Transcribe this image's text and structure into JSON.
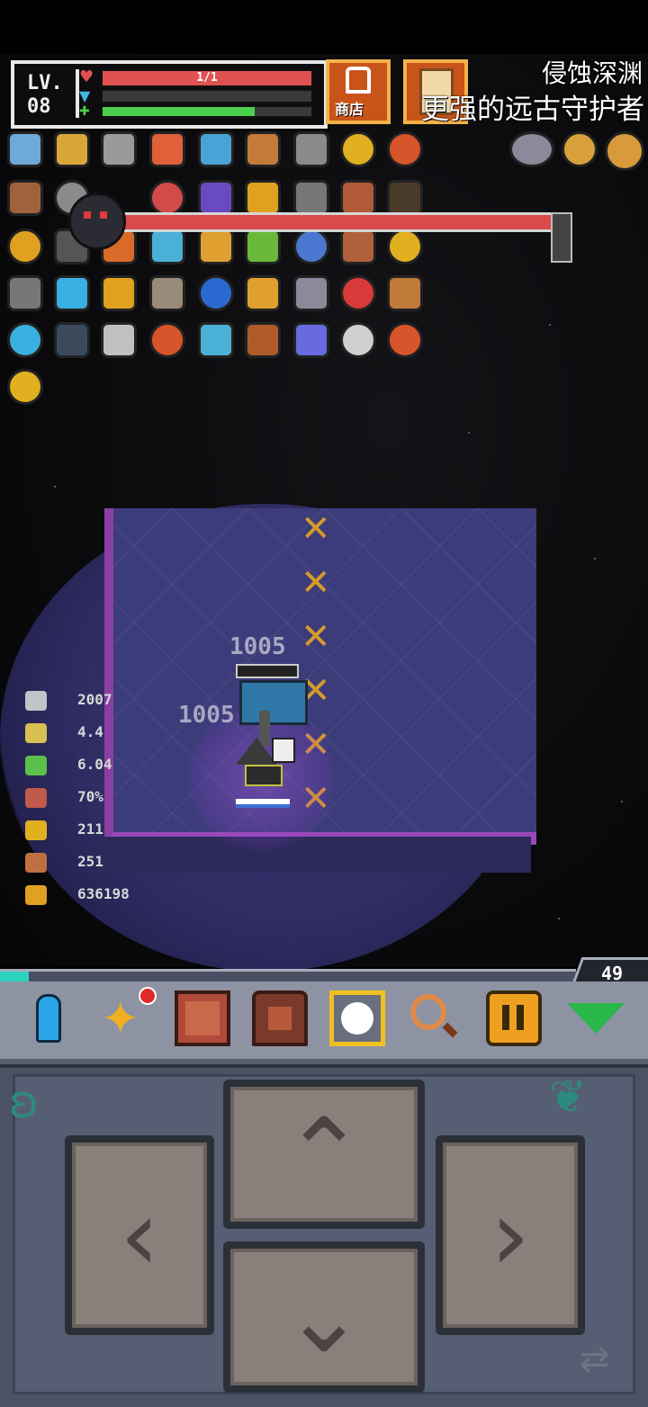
{
  "player": {
    "level_label": "LV.",
    "level_value": "08",
    "hp_text": "1/1",
    "hp_fraction": 1.0,
    "shield_fraction": 0.0,
    "energy_fraction": 0.73
  },
  "top_buttons": {
    "shop_label": "商店",
    "quest_label": ""
  },
  "captions": {
    "line1": "侵蚀深渊",
    "line2": "更强的远古守护者"
  },
  "boss": {
    "hp_fraction": 0.97
  },
  "combat_text": {
    "dmg1": "1005",
    "dmg2": "1005"
  },
  "stats": [
    {
      "icon": "sword-icon",
      "value": "2007"
    },
    {
      "icon": "attack-speed-icon",
      "value": "4.4"
    },
    {
      "icon": "boot-icon",
      "value": "6.04"
    },
    {
      "icon": "shield-icon",
      "value": "70%"
    },
    {
      "icon": "gold-key-icon",
      "value": "211"
    },
    {
      "icon": "bronze-key-icon",
      "value": "251"
    },
    {
      "icon": "coin-icon",
      "value": "636198"
    }
  ],
  "floor": {
    "number": "49",
    "exp_fraction": 0.05
  },
  "toolbar": [
    {
      "icon": "character-icon"
    },
    {
      "icon": "skill-star-icon"
    },
    {
      "icon": "book-icon"
    },
    {
      "icon": "backpack-icon"
    },
    {
      "icon": "focus-target-icon"
    },
    {
      "icon": "magnifier-icon"
    },
    {
      "icon": "pause-icon"
    },
    {
      "icon": "collapse-icon"
    }
  ],
  "colors": {
    "hp": "#e05252",
    "energy": "#4bd04b",
    "exp": "#2cd4c0",
    "boss_hp": "#d94a4a",
    "damage_text": "#ffffff"
  }
}
